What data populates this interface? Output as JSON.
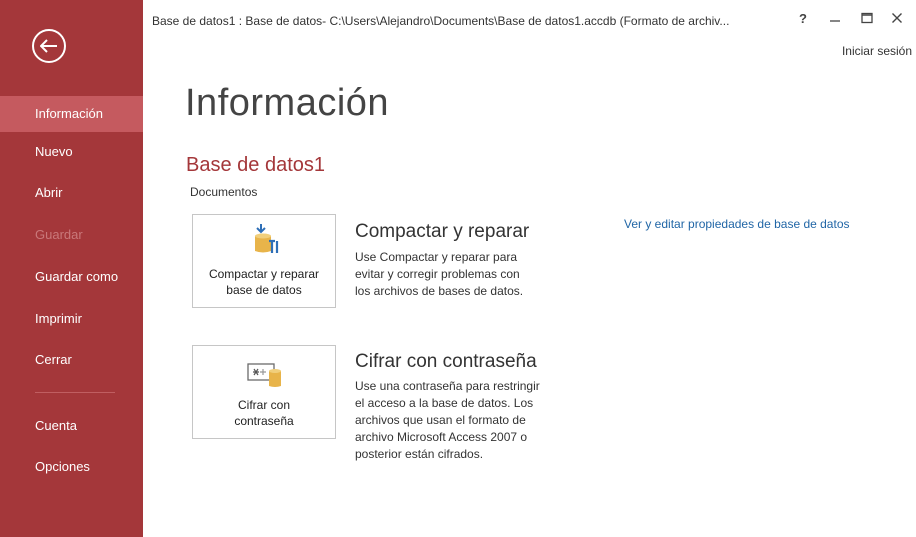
{
  "window": {
    "title": "Base de datos1 : Base de datos- C:\\Users\\Alejandro\\Documents\\Base de datos1.accdb (Formato de archiv...",
    "help_label": "?",
    "sign_in": "Iniciar sesión"
  },
  "sidebar": {
    "items": [
      {
        "label": "Información",
        "state": "active"
      },
      {
        "label": "Nuevo"
      },
      {
        "label": "Abrir"
      },
      {
        "label": "Guardar",
        "state": "disabled"
      },
      {
        "label": "Guardar como"
      },
      {
        "label": "Imprimir"
      },
      {
        "label": "Cerrar"
      },
      {
        "label": "Cuenta"
      },
      {
        "label": "Opciones"
      }
    ]
  },
  "main": {
    "title": "Información",
    "db_name": "Base de datos1",
    "db_location": "Documentos",
    "properties_link": "Ver y editar propiedades de base de datos",
    "sections": [
      {
        "button_line1": "Compactar y reparar",
        "button_line2": "base de datos",
        "title": "Compactar y reparar",
        "desc_lines": [
          "Use Compactar y reparar para",
          "evitar y corregir problemas con",
          "los archivos de bases de datos."
        ],
        "icon": "compact-repair-icon"
      },
      {
        "button_line1": "Cifrar con",
        "button_line2": "contraseña",
        "title": "Cifrar con contraseña",
        "desc_lines": [
          "Use una contraseña para restringir",
          "el acceso a la base de datos. Los",
          "archivos que usan el formato de",
          "archivo Microsoft Access 2007 o",
          "posterior están cifrados."
        ],
        "icon": "encrypt-password-icon"
      }
    ]
  },
  "colors": {
    "accent": "#a4373a",
    "active": "#c55a5f",
    "link": "#2166a6"
  }
}
